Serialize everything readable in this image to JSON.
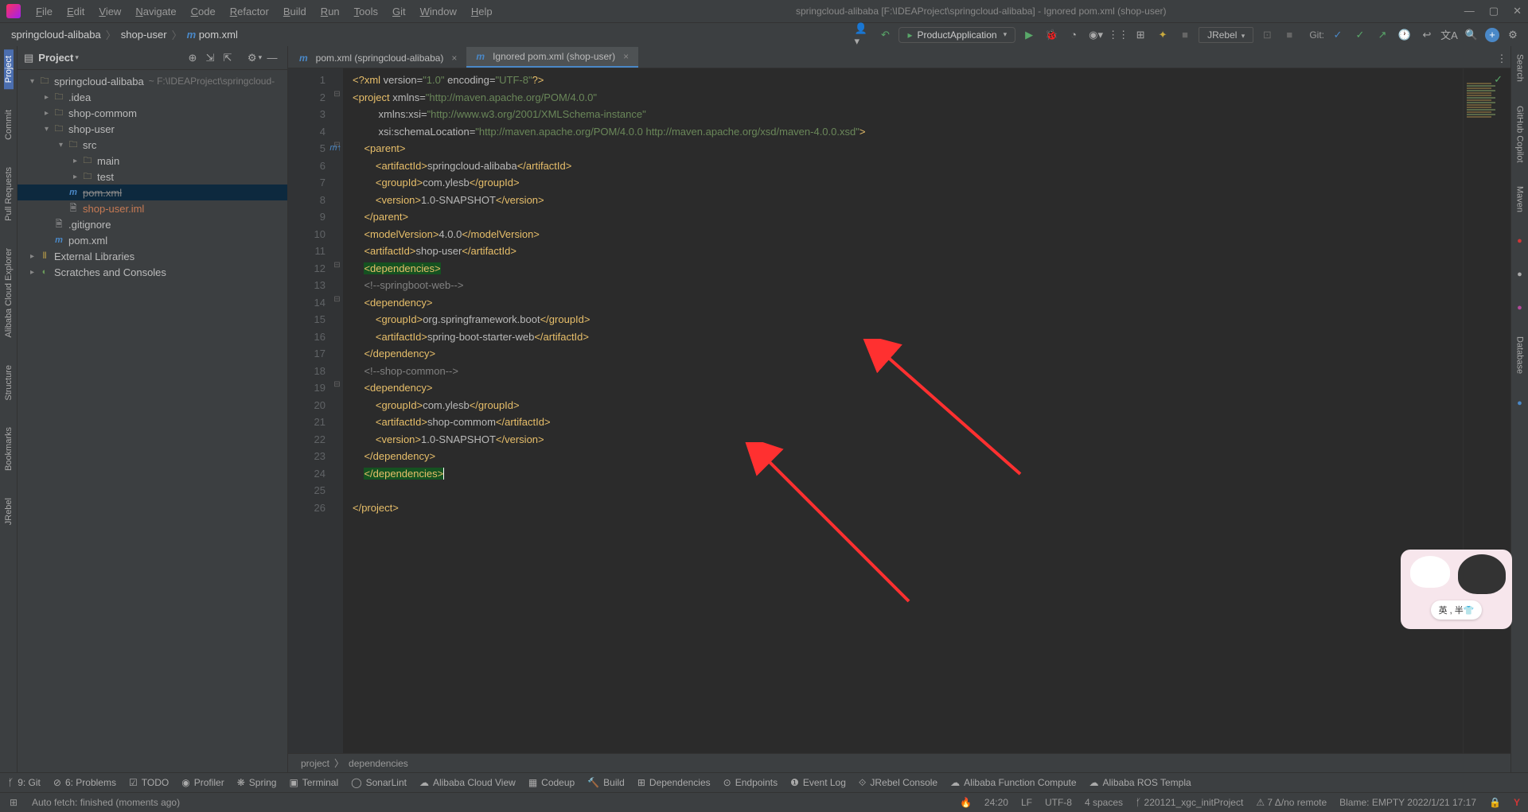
{
  "menu": [
    "File",
    "Edit",
    "View",
    "Navigate",
    "Code",
    "Refactor",
    "Build",
    "Run",
    "Tools",
    "Git",
    "Window",
    "Help"
  ],
  "titlebar": "springcloud-alibaba [F:\\IDEAProject\\springcloud-alibaba] - Ignored pom.xml (shop-user)",
  "crumbs": [
    "springcloud-alibaba",
    "shop-user",
    "pom.xml"
  ],
  "run_config": "ProductApplication",
  "jrebel": "JRebel",
  "git_label": "Git:",
  "project": {
    "label": "Project"
  },
  "tree": [
    {
      "depth": 0,
      "arrow": "▾",
      "icon": "folder",
      "name": "springcloud-alibaba",
      "path": "~ F:\\IDEAProject\\springcloud-"
    },
    {
      "depth": 1,
      "arrow": "▸",
      "icon": "folder",
      "name": ".idea"
    },
    {
      "depth": 1,
      "arrow": "▸",
      "icon": "folder",
      "name": "shop-commom"
    },
    {
      "depth": 1,
      "arrow": "▾",
      "icon": "folder",
      "name": "shop-user"
    },
    {
      "depth": 2,
      "arrow": "▾",
      "icon": "folder",
      "name": "src"
    },
    {
      "depth": 3,
      "arrow": "▸",
      "icon": "folder",
      "name": "main"
    },
    {
      "depth": 3,
      "arrow": "▸",
      "icon": "folder",
      "name": "test"
    },
    {
      "depth": 2,
      "arrow": "",
      "icon": "m",
      "name": "pom.xml",
      "sel": true,
      "strike": true
    },
    {
      "depth": 2,
      "arrow": "",
      "icon": "file",
      "name": "shop-user.iml",
      "color": "#c77a54"
    },
    {
      "depth": 1,
      "arrow": "",
      "icon": "file",
      "name": ".gitignore"
    },
    {
      "depth": 1,
      "arrow": "",
      "icon": "m",
      "name": "pom.xml"
    },
    {
      "depth": 0,
      "arrow": "▸",
      "icon": "lib",
      "name": "External Libraries"
    },
    {
      "depth": 0,
      "arrow": "▸",
      "icon": "scr",
      "name": "Scratches and Consoles"
    }
  ],
  "tabs": [
    {
      "label": "pom.xml (springcloud-alibaba)",
      "active": false
    },
    {
      "label": "Ignored pom.xml (shop-user)",
      "active": true
    }
  ],
  "left_tools": [
    "Project",
    "Commit",
    "Pull Requests",
    "Alibaba Cloud Explorer",
    "Structure",
    "Bookmarks",
    "JRebel"
  ],
  "right_tools": [
    "Search",
    "GitHub Copilot",
    "Maven",
    "",
    "",
    "",
    "Database",
    ""
  ],
  "editor_breadcrumb": [
    "project",
    "dependencies"
  ],
  "bottom_tools": [
    "9: Git",
    "6: Problems",
    "TODO",
    "Profiler",
    "Spring",
    "Terminal",
    "SonarLint",
    "Alibaba Cloud View",
    "Codeup",
    "Build",
    "Dependencies",
    "Endpoints",
    "Event Log",
    "JRebel Console",
    "Alibaba Function Compute",
    "Alibaba ROS Templa"
  ],
  "status_left": "Auto fetch: finished (moments ago)",
  "status_right": [
    "24:20",
    "LF",
    "UTF-8",
    "4 spaces",
    "220121_xgc_initProject",
    "7 Δ/no remote",
    "Blame: EMPTY 2022/1/21 17:17"
  ],
  "code": [
    {
      "n": 1,
      "html": "<span class='pi'>&lt;?xml</span> <span class='attr'>version</span>=<span class='val'>\"1.0\"</span> <span class='attr'>encoding</span>=<span class='val'>\"UTF-8\"</span><span class='pi'>?&gt;</span>"
    },
    {
      "n": 2,
      "html": "<span class='tag'>&lt;project</span> <span class='attr'>xmlns</span>=<span class='val'>\"http://maven.apache.org/POM/4.0.0\"</span>"
    },
    {
      "n": 3,
      "html": "         <span class='attr'>xmlns:xsi</span>=<span class='val'>\"http://www.w3.org/2001/XMLSchema-instance\"</span>"
    },
    {
      "n": 4,
      "html": "         <span class='attr'>xsi:schemaLocation</span>=<span class='val'>\"http://maven.apache.org/POM/4.0.0 http://maven.apache.org/xsd/maven-4.0.0.xsd\"</span><span class='tag'>&gt;</span>"
    },
    {
      "n": 5,
      "html": "    <span class='tag'>&lt;parent&gt;</span>",
      "gut": "mi"
    },
    {
      "n": 6,
      "html": "        <span class='tag'>&lt;artifactId&gt;</span><span class='txt'>springcloud-alibaba</span><span class='tag'>&lt;/artifactId&gt;</span>"
    },
    {
      "n": 7,
      "html": "        <span class='tag'>&lt;groupId&gt;</span><span class='txt'>com.ylesb</span><span class='tag'>&lt;/groupId&gt;</span>"
    },
    {
      "n": 8,
      "html": "        <span class='tag'>&lt;version&gt;</span><span class='txt'>1.0-SNAPSHOT</span><span class='tag'>&lt;/version&gt;</span>"
    },
    {
      "n": 9,
      "html": "    <span class='tag'>&lt;/parent&gt;</span>"
    },
    {
      "n": 10,
      "html": "    <span class='tag'>&lt;modelVersion&gt;</span><span class='txt'>4.0.0</span><span class='tag'>&lt;/modelVersion&gt;</span>"
    },
    {
      "n": 11,
      "html": "    <span class='tag'>&lt;artifactId&gt;</span><span class='txt'>shop-user</span><span class='tag'>&lt;/artifactId&gt;</span>"
    },
    {
      "n": 12,
      "html": "    <span class='sel-bg'><span class='tag'>&lt;dependencies&gt;</span></span>"
    },
    {
      "n": 13,
      "html": "    <span class='cmt'>&lt;!--springboot-web--&gt;</span>"
    },
    {
      "n": 14,
      "html": "    <span class='tag'>&lt;dependency&gt;</span>",
      "gut": "dep"
    },
    {
      "n": 15,
      "html": "        <span class='tag'>&lt;groupId&gt;</span><span class='txt'>org.springframework.boot</span><span class='tag'>&lt;/groupId&gt;</span>"
    },
    {
      "n": 16,
      "html": "        <span class='tag'>&lt;artifactId&gt;</span><span class='txt'>spring-boot-starter-web</span><span class='tag'>&lt;/artifactId&gt;</span>"
    },
    {
      "n": 17,
      "html": "    <span class='tag'>&lt;/dependency&gt;</span>"
    },
    {
      "n": 18,
      "html": "    <span class='cmt'>&lt;!--shop-common--&gt;</span>"
    },
    {
      "n": 19,
      "html": "    <span class='tag'>&lt;dependency&gt;</span>"
    },
    {
      "n": 20,
      "html": "        <span class='tag'>&lt;groupId&gt;</span><span class='txt'>com.ylesb</span><span class='tag'>&lt;/groupId&gt;</span>"
    },
    {
      "n": 21,
      "html": "        <span class='tag'>&lt;artifactId&gt;</span><span class='txt'>shop-commom</span><span class='tag'>&lt;/artifactId&gt;</span>"
    },
    {
      "n": 22,
      "html": "        <span class='tag'>&lt;version&gt;</span><span class='txt'>1.0-SNAPSHOT</span><span class='tag'>&lt;/version&gt;</span>"
    },
    {
      "n": 23,
      "html": "    <span class='tag'>&lt;/dependency&gt;</span>"
    },
    {
      "n": 24,
      "html": "    <span class='sel-bg'><span class='tag'>&lt;/dependencies&gt;</span></span><span class='caret'></span>"
    },
    {
      "n": 25,
      "html": ""
    },
    {
      "n": 26,
      "html": "<span class='tag'>&lt;/project&gt;</span>"
    }
  ],
  "mascot_text": "英 , 半👕"
}
